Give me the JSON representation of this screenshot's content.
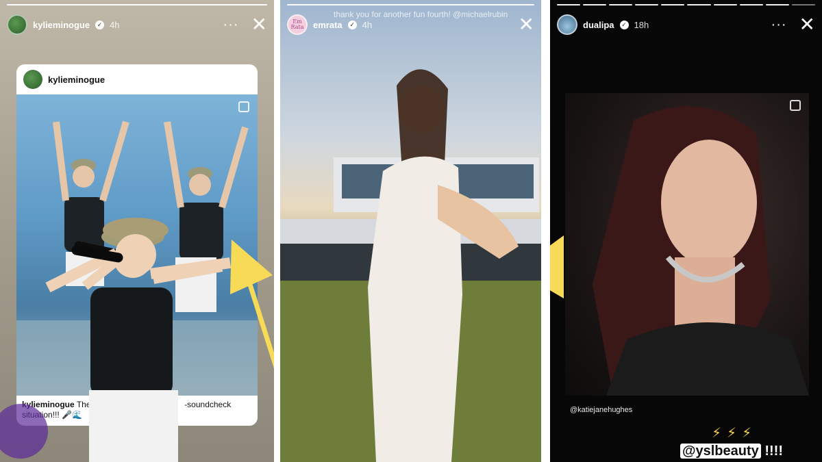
{
  "stories": [
    {
      "username": "kylieminogue",
      "time": "4h",
      "verified": true,
      "avatar_color": "#3f8a3c",
      "post": {
        "username": "kylieminogue",
        "caption_user": "kylieminogue",
        "caption_start": "The",
        "caption_end": "-soundcheck",
        "caption_line2": "situation!!! 🎤🌊"
      }
    },
    {
      "username": "emrata",
      "time": "4h",
      "verified": true,
      "avatar_text": "Em Rata",
      "avatar_color": "#f3cfe0",
      "caption": "thank you for another fun fourth! @michaelrubin"
    },
    {
      "username": "dualipa",
      "time": "18h",
      "verified": true,
      "avatar_color": "#5a86a6",
      "credit": "@katiejanehughes",
      "bolts": "⚡⚡⚡",
      "mention": "@yslbeauty",
      "mention_suffix": "!!!!"
    }
  ],
  "icons": {
    "more": "···",
    "close": "✕",
    "verified": "✓"
  },
  "colors": {
    "arrow": "#f7db57",
    "story_bg_dark": "#070707"
  }
}
